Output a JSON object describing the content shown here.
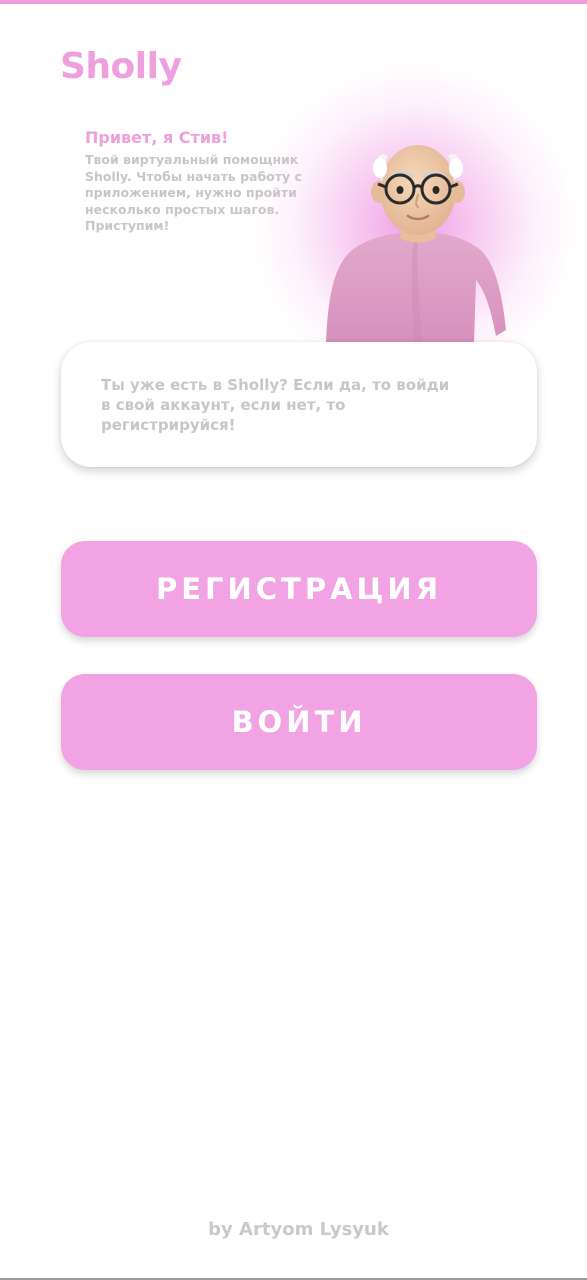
{
  "app": {
    "logo": "Sholly"
  },
  "assistant": {
    "greeting": "Привет, я Стив!",
    "intro": "Твой виртуальный помощник\nSholly. Чтобы начать работу с\nприложением, нужно пройти\nнесколько простых шагов.\nПриступим!",
    "avatar_icon": "assistant-avatar-steve"
  },
  "info_card": {
    "text": "Ты уже есть в Sholly? Если да, то войди\nв свой аккаунт, если нет, то\nрегистрируйся!"
  },
  "buttons": {
    "register_label": "РЕГИСТРАЦИЯ",
    "login_label": "ВОЙТИ"
  },
  "footer": {
    "credit": "by Artyom Lysyuk"
  },
  "colors": {
    "accent": "#ef9fdb",
    "button": "#f1a3e3",
    "muted_text": "#c7c7c7"
  }
}
